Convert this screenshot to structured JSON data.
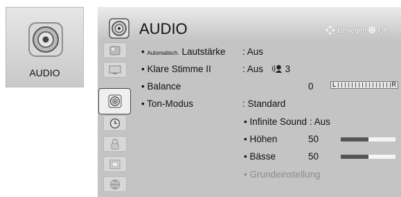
{
  "tile": {
    "label": "AUDIO",
    "icon": "speaker-icon"
  },
  "header": {
    "title": "AUDIO",
    "nav_move": "Bewegen",
    "nav_ok": "OK"
  },
  "sidebar": {
    "items": [
      {
        "icon": "picture-icon"
      },
      {
        "icon": "screen-icon"
      },
      {
        "icon": "speaker-icon",
        "selected": true
      },
      {
        "icon": "clock-icon"
      },
      {
        "icon": "lock-icon"
      },
      {
        "icon": "options-icon"
      },
      {
        "icon": "network-icon"
      }
    ]
  },
  "settings": {
    "auto_volume": {
      "prefix": "Automatisch.",
      "label": "Lautstärke",
      "value": ": Aus"
    },
    "clear_voice": {
      "label": "Klare Stimme II",
      "value": ": Aus",
      "level": "3"
    },
    "balance": {
      "label": "Balance",
      "value": "0",
      "left": "L",
      "right": "R"
    },
    "sound_mode": {
      "label": "Ton-Modus",
      "value": ": Standard"
    },
    "infinite_sound": {
      "label": "• Infinite Sound",
      "value": ": Aus"
    },
    "treble": {
      "label": "• Höhen",
      "value": "50",
      "level": 0.5
    },
    "bass": {
      "label": "• Bässe",
      "value": "50",
      "level": 0.5
    },
    "reset": {
      "label": "• Grundeinstellung"
    }
  },
  "colors": {
    "panel": "#c4c4c4",
    "bar_fill": "#555555",
    "bar_track": "#f4f4f4"
  }
}
